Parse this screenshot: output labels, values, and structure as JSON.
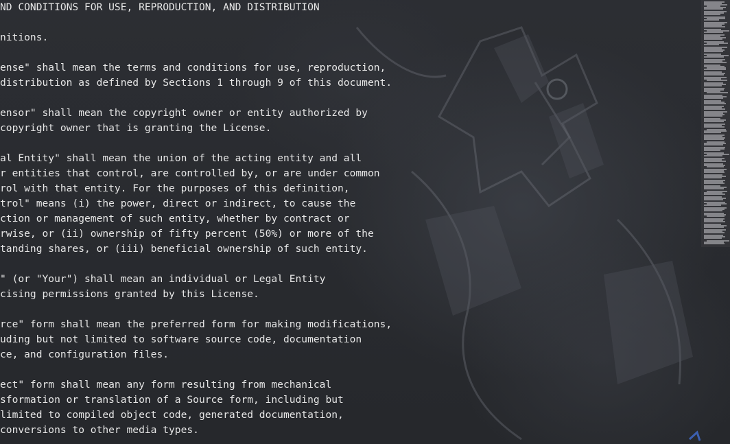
{
  "editor": {
    "lines": [
      "ND CONDITIONS FOR USE, REPRODUCTION, AND DISTRIBUTION",
      "",
      "nitions.",
      "",
      "ense\" shall mean the terms and conditions for use, reproduction,",
      "distribution as defined by Sections 1 through 9 of this document.",
      "",
      "ensor\" shall mean the copyright owner or entity authorized by",
      "copyright owner that is granting the License.",
      "",
      "al Entity\" shall mean the union of the acting entity and all",
      "r entities that control, are controlled by, or are under common",
      "rol with that entity. For the purposes of this definition,",
      "trol\" means (i) the power, direct or indirect, to cause the",
      "ction or management of such entity, whether by contract or",
      "rwise, or (ii) ownership of fifty percent (50%) or more of the",
      "tanding shares, or (iii) beneficial ownership of such entity.",
      "",
      "\" (or \"Your\") shall mean an individual or Legal Entity",
      "cising permissions granted by this License.",
      "",
      "rce\" form shall mean the preferred form for making modifications,",
      "uding but not limited to software source code, documentation",
      "ce, and configuration files.",
      "",
      "ect\" form shall mean any form resulting from mechanical",
      "sformation or translation of a Source form, including but",
      "limited to compiled object code, generated documentation,",
      "conversions to other media types."
    ]
  },
  "minimap": {
    "visible": true
  },
  "theme": {
    "background": "#2a2c31",
    "text": "#e6e6e6"
  }
}
